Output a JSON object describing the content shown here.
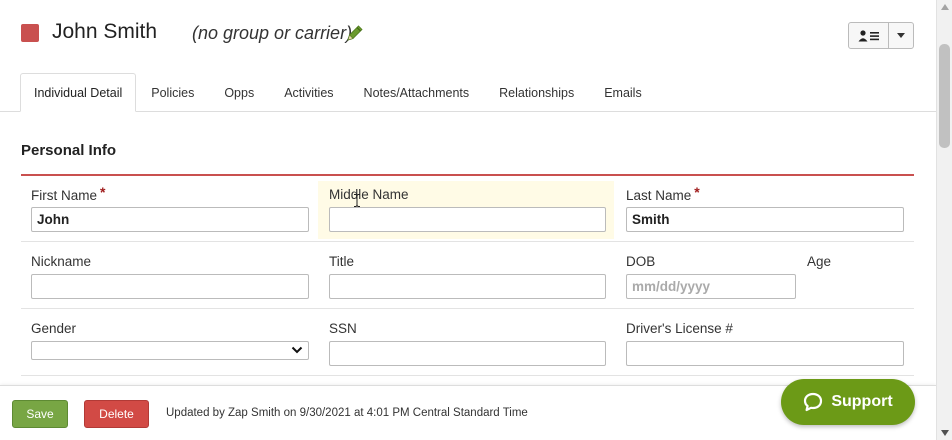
{
  "header": {
    "name": "John Smith",
    "group": "(no group or carrier)",
    "status_color": "#c9504f"
  },
  "tabs": [
    {
      "label": "Individual Detail",
      "active": true
    },
    {
      "label": "Policies"
    },
    {
      "label": "Opps"
    },
    {
      "label": "Activities"
    },
    {
      "label": "Notes/Attachments"
    },
    {
      "label": "Relationships"
    },
    {
      "label": "Emails"
    }
  ],
  "section": {
    "title": "Personal Info"
  },
  "form": {
    "first_name": {
      "label": "First Name",
      "value": "John",
      "required": "*"
    },
    "middle_name": {
      "label": "Middle Name",
      "value": ""
    },
    "last_name": {
      "label": "Last Name",
      "value": "Smith",
      "required": "*"
    },
    "nickname": {
      "label": "Nickname",
      "value": ""
    },
    "title": {
      "label": "Title",
      "value": ""
    },
    "dob": {
      "label": "DOB",
      "placeholder": "mm/dd/yyyy"
    },
    "age": {
      "label": "Age"
    },
    "gender": {
      "label": "Gender",
      "value": ""
    },
    "ssn": {
      "label": "SSN",
      "value": ""
    },
    "drivers_license": {
      "label": "Driver's License #",
      "value": ""
    }
  },
  "footer": {
    "save_label": "Save",
    "delete_label": "Delete",
    "updated_text": "Updated by Zap Smith on 9/30/2021 at 4:01 PM Central Standard Time"
  },
  "support": {
    "label": "Support",
    "color": "#6c9a17"
  },
  "icons": [
    "pencil-icon",
    "contact-card-icon",
    "caret-down-icon",
    "chat-bubble-icon",
    "text-cursor-icon"
  ]
}
